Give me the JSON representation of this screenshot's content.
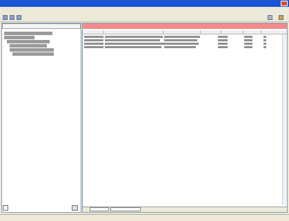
{
  "window": {
    "title": ""
  },
  "menubar": {
    "items": []
  },
  "toolbar": {
    "buttons": [
      "",
      "",
      ""
    ]
  },
  "left_pane": {
    "filter_value": "",
    "tree_items": [
      "",
      "",
      "",
      "",
      "",
      ""
    ]
  },
  "right_pane": {
    "header_text": "",
    "table": {
      "columns": [
        "",
        "",
        "",
        "",
        "",
        "",
        ""
      ],
      "rows": [
        [
          "",
          "",
          "",
          "",
          "",
          "",
          ""
        ],
        [
          "",
          "",
          "",
          "",
          "",
          "",
          ""
        ],
        [
          "",
          "",
          "",
          "",
          "",
          "",
          ""
        ],
        [
          "",
          "",
          "",
          "",
          "",
          "",
          ""
        ]
      ]
    },
    "tabs": [
      "",
      ""
    ]
  },
  "statusbar": {
    "text": ""
  },
  "colors": {
    "titlebar": "#1b55d6",
    "header_strip": "#f28b8b",
    "window_bg": "#ece9d8"
  }
}
